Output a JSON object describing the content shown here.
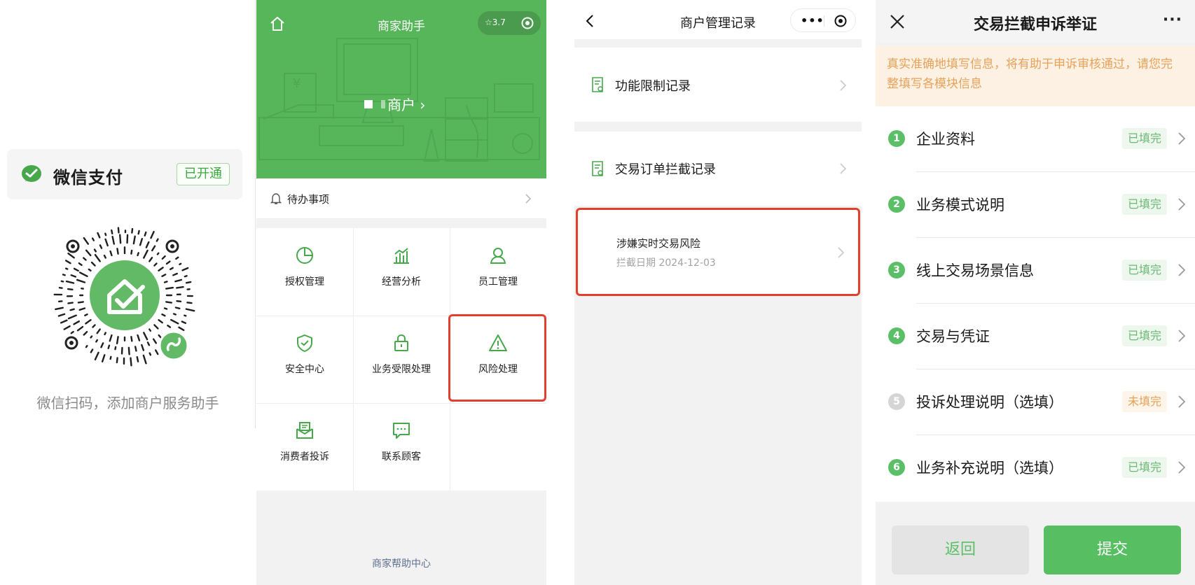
{
  "panel1": {
    "brand": "微信支付",
    "status_badge": "已开通",
    "qr_caption": "微信扫码，添加商户服务助手"
  },
  "panel2": {
    "title": "商家助手",
    "rating": "☆3.7",
    "merchant_label": "商户 ›",
    "todo_label": "待办事项",
    "grid": [
      {
        "label": "授权管理",
        "icon": "pie-chart-icon"
      },
      {
        "label": "经营分析",
        "icon": "bar-chart-icon"
      },
      {
        "label": "员工管理",
        "icon": "person-icon"
      },
      {
        "label": "安全中心",
        "icon": "shield-icon"
      },
      {
        "label": "业务受限处理",
        "icon": "lock-icon"
      },
      {
        "label": "风险处理",
        "icon": "warning-icon"
      },
      {
        "label": "消费者投诉",
        "icon": "mail-icon"
      },
      {
        "label": "联系顾客",
        "icon": "chat-icon"
      }
    ],
    "help_link": "商家帮助中心"
  },
  "panel3": {
    "title": "商户管理记录",
    "capsule_dots": "•••",
    "rows": [
      {
        "label": "功能限制记录"
      },
      {
        "label": "交易订单拦截记录"
      }
    ],
    "record": {
      "title": "涉嫌实时交易风险",
      "date": "拦截日期 2024-12-03"
    }
  },
  "panel4": {
    "title": "交易拦截申诉举证",
    "more": "···",
    "notice": "真实准确地填写信息，将有助于申诉审核通过，请您完整填写各模块信息",
    "steps": [
      {
        "num": "1",
        "label": "企业资料",
        "status": "已填完",
        "done": true
      },
      {
        "num": "2",
        "label": "业务模式说明",
        "status": "已填完",
        "done": true
      },
      {
        "num": "3",
        "label": "线上交易场景信息",
        "status": "已填完",
        "done": true
      },
      {
        "num": "4",
        "label": "交易与凭证",
        "status": "已填完",
        "done": true
      },
      {
        "num": "5",
        "label": "投诉处理说明（选填）",
        "status": "未填完",
        "done": false
      },
      {
        "num": "6",
        "label": "业务补充说明（选填）",
        "status": "已填完",
        "done": true
      }
    ],
    "back_button": "返回",
    "submit_button": "提交"
  },
  "colors": {
    "wechat_green": "#57b55a",
    "highlight_red": "#e2402f",
    "warning_orange": "#e7a159"
  }
}
